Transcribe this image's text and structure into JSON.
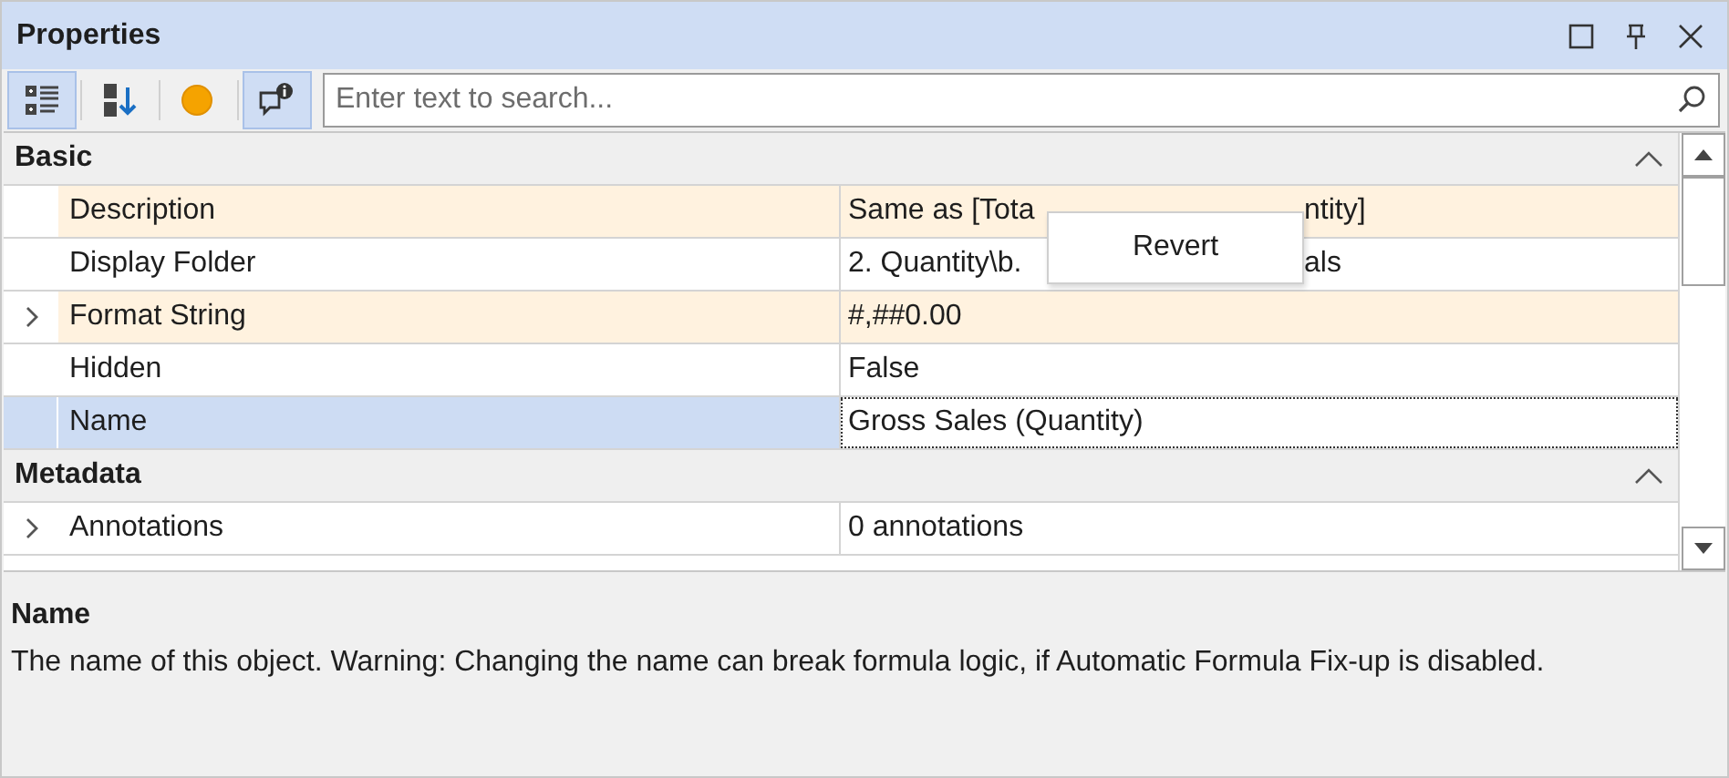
{
  "window": {
    "title": "Properties"
  },
  "toolbar": {
    "buttons": [
      {
        "kind": "categorized",
        "selected": true
      },
      {
        "kind": "alphabetical",
        "selected": false
      },
      {
        "kind": "status",
        "selected": false
      },
      {
        "kind": "comment",
        "selected": true
      }
    ]
  },
  "search": {
    "placeholder": "Enter text to search..."
  },
  "grid": {
    "categories": [
      {
        "name": "Basic",
        "expanded": true,
        "properties": [
          {
            "name": "Description",
            "value_parts": [
              "Same as [Tota",
              "ntity]"
            ],
            "modified": true,
            "expandable": false,
            "selected": false
          },
          {
            "name": "Display Folder",
            "value_parts": [
              "2. Quantity\\b.",
              "als"
            ],
            "modified": false,
            "expandable": false,
            "selected": false
          },
          {
            "name": "Format String",
            "value_parts": [
              "#,##0.00"
            ],
            "modified": true,
            "expandable": true,
            "selected": false
          },
          {
            "name": "Hidden",
            "value_parts": [
              "False"
            ],
            "modified": false,
            "expandable": false,
            "selected": false
          },
          {
            "name": "Name",
            "value_parts": [
              "Gross Sales (Quantity)"
            ],
            "modified": false,
            "expandable": false,
            "selected": true
          }
        ]
      },
      {
        "name": "Metadata",
        "expanded": true,
        "properties": [
          {
            "name": "Annotations",
            "value_parts": [
              "0 annotations"
            ],
            "modified": false,
            "expandable": true,
            "selected": false
          }
        ]
      }
    ]
  },
  "context_menu": {
    "items": [
      "Revert"
    ]
  },
  "help": {
    "title": "Name",
    "text": "The name of this object. Warning: Changing the name can break formula logic, if Automatic Formula Fix-up is disabled."
  }
}
